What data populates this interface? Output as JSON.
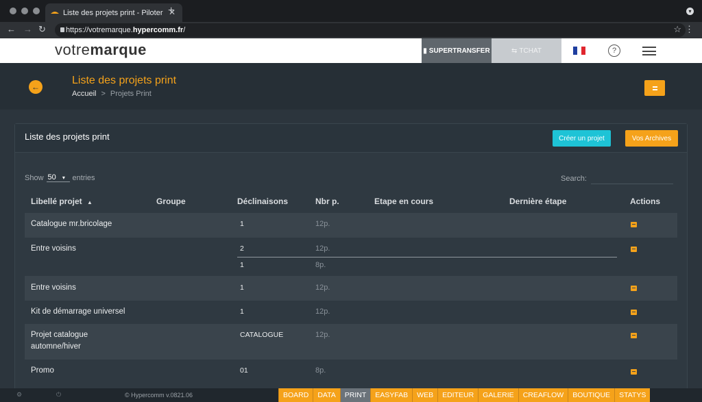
{
  "browser": {
    "tab_title": "Liste des projets print - Piloter",
    "url_prefix": "https://votremarque.",
    "url_host": "hypercomm.fr",
    "url_suffix": "/"
  },
  "header": {
    "logo_light": "votre",
    "logo_bold": "marque",
    "supertransfer": "SUPERTRANSFER",
    "tchat": "TCHAT",
    "help": "?"
  },
  "page": {
    "title": "Liste des projets print",
    "breadcrumb_home": "Accueil",
    "breadcrumb_sep": ">",
    "breadcrumb_current": "Projets Print"
  },
  "panel": {
    "title": "Liste des projets print",
    "create_label": "Créer un projet",
    "archives_label": "Vos Archives",
    "show_label": "Show",
    "show_value": "50",
    "entries_label": "entries",
    "search_label": "Search:"
  },
  "table": {
    "headers": [
      "Libellé projet",
      "Groupe",
      "Déclinaisons",
      "Nbr p.",
      "Etape en cours",
      "Dernière étape",
      "Actions"
    ],
    "rows": [
      {
        "label": "Catalogue mr.bricolage",
        "decl": "1",
        "pages": "12p."
      },
      {
        "label": "Entre voisins",
        "decl": "2",
        "pages": "12p.",
        "decl2": "1",
        "pages2": "8p."
      },
      {
        "label": "Entre voisins",
        "decl": "1",
        "pages": "12p."
      },
      {
        "label": "Kit de démarrage universel",
        "decl": "1",
        "pages": "12p."
      },
      {
        "label": "Projet catalogue",
        "label2": "automne/hiver",
        "decl": "CATALOGUE",
        "pages": "12p."
      },
      {
        "label": "Promo",
        "decl": "01",
        "pages": "8p."
      }
    ]
  },
  "footer": {
    "copyright": "© Hypercomm v.0821.06",
    "nav": [
      "BOARD",
      "DATA",
      "PRINT",
      "EASYFAB",
      "WEB",
      "EDITEUR",
      "GALERIE",
      "CREAFLOW",
      "BOUTIQUE",
      "STATYS"
    ],
    "active": "PRINT"
  },
  "colors": {
    "accent": "#f5a21a",
    "cyan": "#1ec3d6",
    "bg": "#2c353d"
  }
}
